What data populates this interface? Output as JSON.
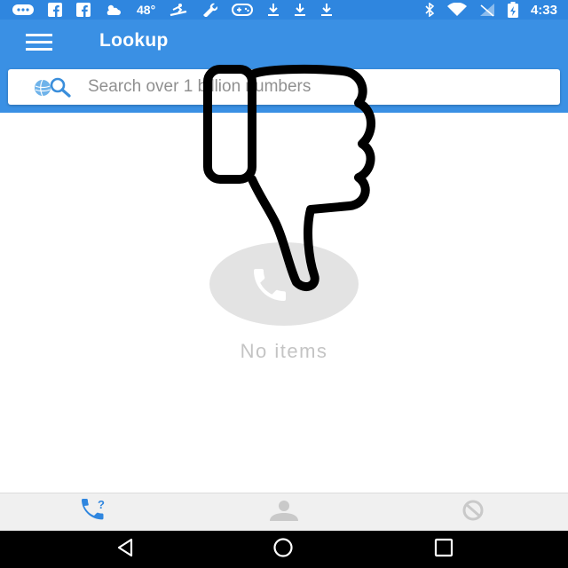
{
  "status_bar": {
    "temperature": "48°",
    "time": "4:33"
  },
  "app_bar": {
    "title": "Lookup"
  },
  "search": {
    "placeholder": "Search over 1 billion numbers",
    "value": ""
  },
  "empty_state": {
    "message": "No items"
  },
  "colors": {
    "primary": "#3a90e4",
    "status_bar": "#2f86df",
    "tab_active": "#2f86df",
    "tab_inactive": "#c9c9c9",
    "empty_text": "#c4c4c4"
  },
  "bottom_nav": {
    "tabs": [
      {
        "icon": "phone-question-icon",
        "active": true
      },
      {
        "icon": "person-icon",
        "active": false
      },
      {
        "icon": "blocked-icon",
        "active": false
      }
    ]
  },
  "system_nav": {
    "buttons": [
      "back-icon",
      "home-icon",
      "recents-icon"
    ]
  }
}
